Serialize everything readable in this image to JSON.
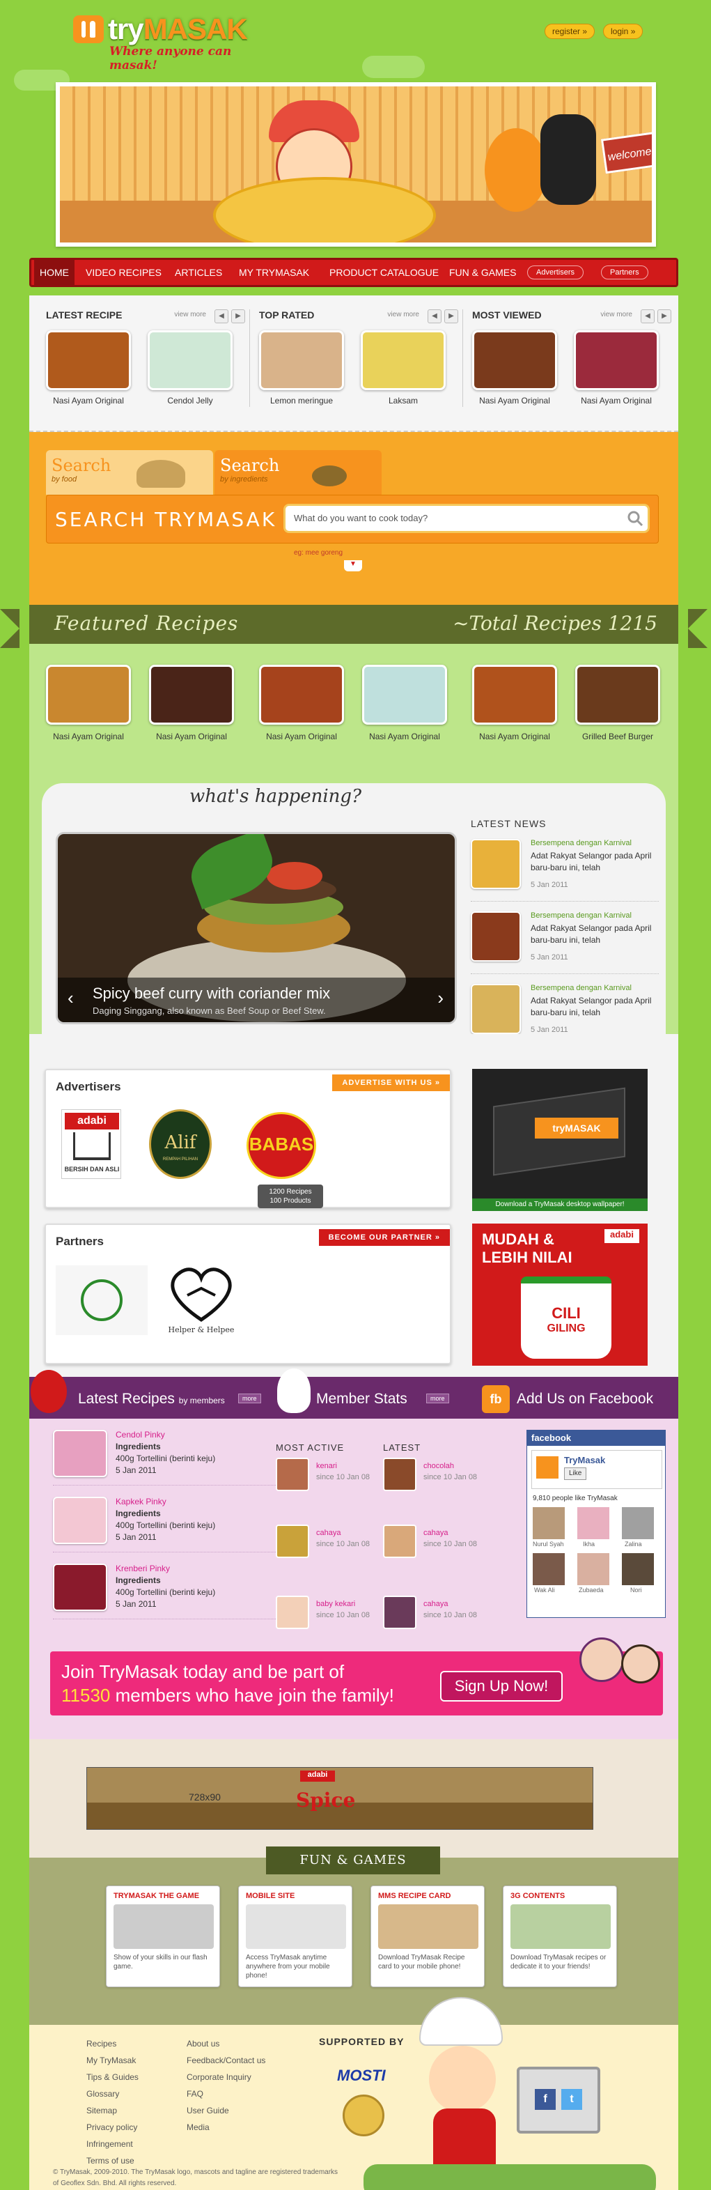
{
  "header": {
    "logo_prefix": "try",
    "logo_word": "MASAK",
    "tagline": "Where anyone can masak!",
    "register": "register »",
    "login": "login »",
    "banner_welcome": "welcome!"
  },
  "nav": {
    "items": [
      "HOME",
      "VIDEO RECIPES",
      "ARTICLES",
      "MY TRYMASAK",
      "PRODUCT CATALOGUE",
      "FUN & GAMES"
    ],
    "pills": [
      "Advertisers",
      "Partners"
    ]
  },
  "recipes": {
    "view_more": "view more",
    "columns": [
      {
        "title": "LATEST RECIPE",
        "items": [
          "Nasi Ayam Original",
          "Cendol Jelly"
        ]
      },
      {
        "title": "TOP RATED",
        "items": [
          "Lemon meringue",
          "Laksam"
        ]
      },
      {
        "title": "MOST VIEWED",
        "items": [
          "Nasi Ayam Original",
          "Nasi Ayam Original"
        ]
      }
    ]
  },
  "search": {
    "tab1_big": "Search",
    "tab1_small": "by food",
    "tab2_big": "Search",
    "tab2_small": "by ingredients",
    "label": "SEARCH TRYMASAK",
    "placeholder": "What do you want to cook today?",
    "hint": "eg: mee goreng"
  },
  "featured": {
    "title": "Featured Recipes",
    "total": "~Total Recipes 1215",
    "items": [
      "Nasi Ayam Original",
      "Nasi Ayam Original",
      "Nasi Ayam Original",
      "Nasi Ayam Original",
      "Nasi Ayam Original",
      "Grilled Beef Burger"
    ]
  },
  "happening": {
    "title": "what's happening?",
    "slide_title": "Spicy beef curry with coriander mix",
    "slide_sub": "Daging Singgang, also known as Beef Soup or Beef Stew.",
    "news_title": "LATEST NEWS",
    "news": [
      {
        "head": "Bersempena dengan Karnival",
        "body": "Adat Rakyat Selangor pada April baru-baru ini, telah",
        "date": "5 Jan 2011"
      },
      {
        "head": "Bersempena dengan Karnival",
        "body": "Adat Rakyat Selangor pada April baru-baru ini, telah",
        "date": "5 Jan 2011"
      },
      {
        "head": "Bersempena dengan Karnival",
        "body": "Adat Rakyat Selangor pada April baru-baru ini, telah",
        "date": "5 Jan 2011"
      }
    ]
  },
  "advertisers": {
    "title": "Advertisers",
    "cta": "ADVERTISE WITH US »",
    "brands": [
      "adabi",
      "Alif",
      "BABAS"
    ],
    "adabi_caption": "BERSIH DAN ASLI",
    "alif_caption": "REMPAH PILIHAN",
    "babas_label": "BABAS",
    "tooltip_l1": "1200 Recipes",
    "tooltip_l2": "100 Products",
    "wallpaper_caption": "Download a TryMasak desktop wallpaper!",
    "wallpaper_logo": "tryMASAK"
  },
  "partners": {
    "title": "Partners",
    "cta": "BECOME OUR PARTNER »",
    "helper_caption": "Helper & Helpee",
    "promo_line1": "MUDAH &",
    "promo_line2": "LEBIH NILAI",
    "promo_brand": "adabi",
    "promo_product1": "CILI",
    "promo_product2": "GILING"
  },
  "members": {
    "latest_title": "Latest Recipes",
    "latest_by": "by members",
    "more": "more",
    "stats_title": "Member Stats",
    "facebook_title": "Add Us on Facebook",
    "latest": [
      {
        "name": "Cendol Pinky",
        "l1": "Ingredients",
        "l2": "400g Tortellini (berinti keju)",
        "l3": "5 Jan 2011"
      },
      {
        "name": "Kapkek Pinky",
        "l1": "Ingredients",
        "l2": "400g Tortellini (berinti keju)",
        "l3": "5 Jan 2011"
      },
      {
        "name": "Krenberi Pinky",
        "l1": "Ingredients",
        "l2": "400g Tortellini (berinti keju)",
        "l3": "5 Jan 2011"
      }
    ],
    "most_active_label": "MOST ACTIVE",
    "latest_label": "LATEST",
    "active": [
      {
        "name": "kenari",
        "since": "since 10 Jan 08"
      },
      {
        "name": "cahaya",
        "since": "since 10 Jan 08"
      },
      {
        "name": "baby kekari",
        "since": "since 10 Jan 08"
      }
    ],
    "newest": [
      {
        "name": "chocolah",
        "since": "since 10 Jan 08"
      },
      {
        "name": "cahaya",
        "since": "since 10 Jan 08"
      },
      {
        "name": "cahaya",
        "since": "since 10 Jan 08"
      }
    ],
    "fb": {
      "brand": "facebook",
      "page": "TryMasak",
      "like": "Like",
      "count": "9,810 people like TryMasak",
      "fans": [
        "Nurul Syah",
        "Ikha",
        "Zalina",
        "Wak Ali",
        "Zubaeda",
        "Nori"
      ]
    },
    "join_line1": "Join TryMasak today and be part of",
    "join_count": "11530",
    "join_line2": "members who have join the family!",
    "signup": "Sign Up Now!"
  },
  "ad_strip": {
    "size": "728x90",
    "brand": "adabi",
    "word": "Spice"
  },
  "fun": {
    "title": "FUN & GAMES",
    "cards": [
      {
        "head": "TRYMASAK THE GAME",
        "desc": "Show of your skills in our flash game."
      },
      {
        "head": "MOBILE SITE",
        "desc": "Access TryMasak anytime anywhere from your mobile phone!"
      },
      {
        "head": "MMS RECIPE CARD",
        "desc": "Download TryMasak Recipe card to your mobile phone!"
      },
      {
        "head": "3G CONTENTS",
        "desc": "Download TryMasak recipes or dedicate it to your friends!"
      }
    ]
  },
  "footer": {
    "col1": [
      "Recipes",
      "My TryMasak",
      "Tips & Guides",
      "Glossary",
      "Sitemap",
      "Privacy policy",
      "Infringement",
      "Terms of use"
    ],
    "col2": [
      "About us",
      "Feedback/Contact us",
      "Corporate Inquiry",
      "FAQ",
      "User Guide",
      "Media"
    ],
    "supported": "SUPPORTED BY",
    "mosti": "MOSTI",
    "copyright": "© TryMasak, 2009-2010. The TryMasak logo, mascots and tagline are registered trademarks of Geoflex Sdn. Bhd. All rights reserved."
  },
  "colors": {
    "brand_orange": "#f7931e",
    "nav_red": "#d11a1a",
    "green_bg": "#8fd13f",
    "purple": "#6a2a6b",
    "pink": "#ee2a7b"
  }
}
